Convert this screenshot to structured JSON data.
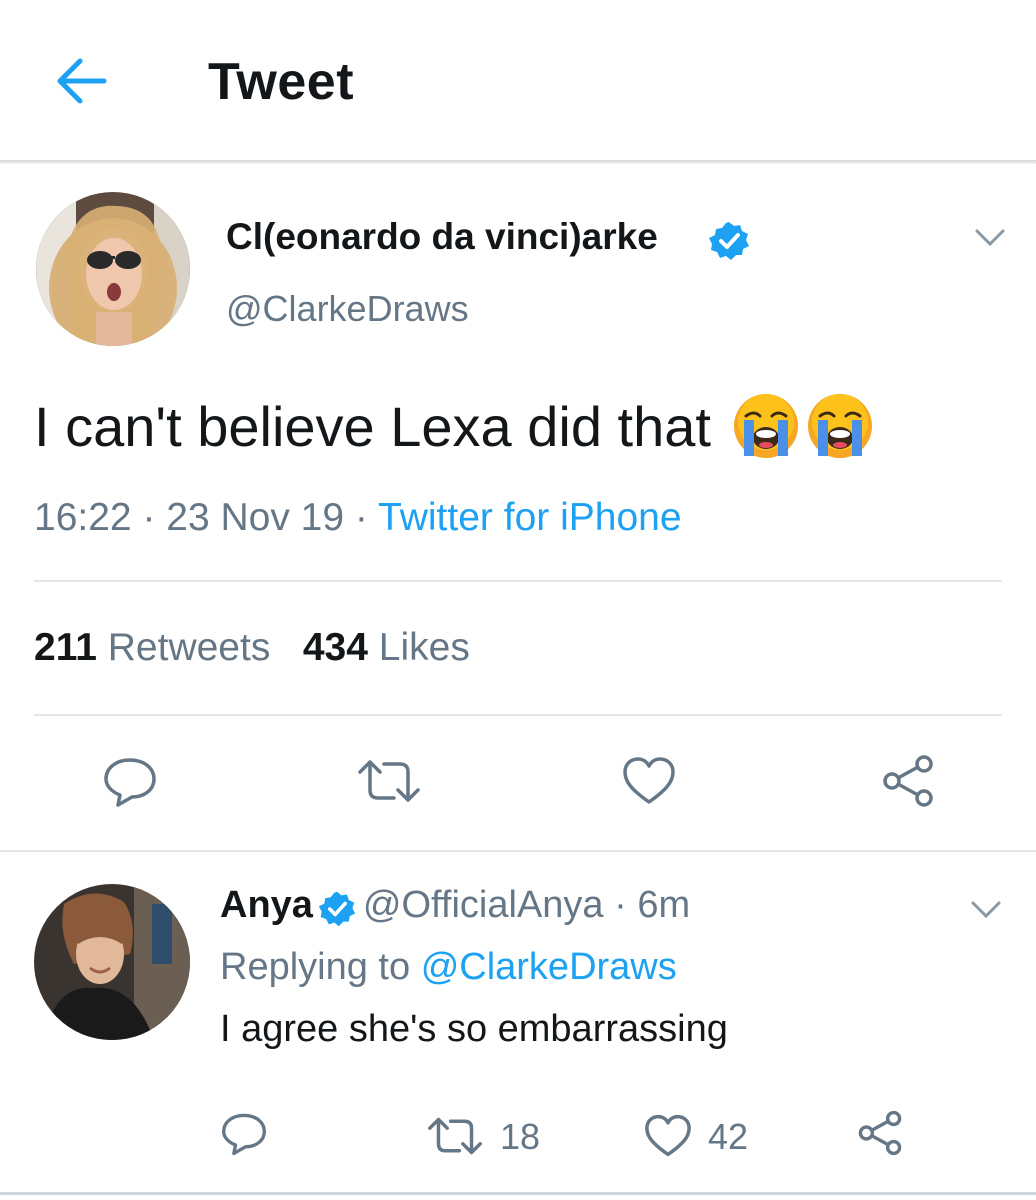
{
  "header": {
    "title": "Tweet"
  },
  "tweet": {
    "display_name": "Cl(eonardo da vinci)arke",
    "handle": "@ClarkeDraws",
    "text": "I can't believe Lexa did that",
    "emojis": [
      "loudly-crying-face",
      "loudly-crying-face"
    ],
    "time": "16:22",
    "date": "23 Nov 19",
    "source": "Twitter for iPhone",
    "retweets_count": "211",
    "retweets_label": "Retweets",
    "likes_count": "434",
    "likes_label": "Likes"
  },
  "reply": {
    "display_name": "Anya",
    "handle": "@OfficialAnya",
    "time": "6m",
    "replying_prefix": "Replying to",
    "replying_to": "@ClarkeDraws",
    "text": "I agree she's so embarrassing",
    "retweets": "18",
    "likes": "42"
  },
  "icons": {
    "back": "arrow-left-icon",
    "verified": "verified-badge-icon",
    "caret": "chevron-down-icon",
    "reply": "reply-bubble-icon",
    "retweet": "retweet-icon",
    "like": "heart-icon",
    "share": "share-icon"
  },
  "colors": {
    "accent": "#1da1f2",
    "secondary_text": "#657786",
    "primary_text": "#14171a",
    "divider": "#e1e8ed"
  }
}
